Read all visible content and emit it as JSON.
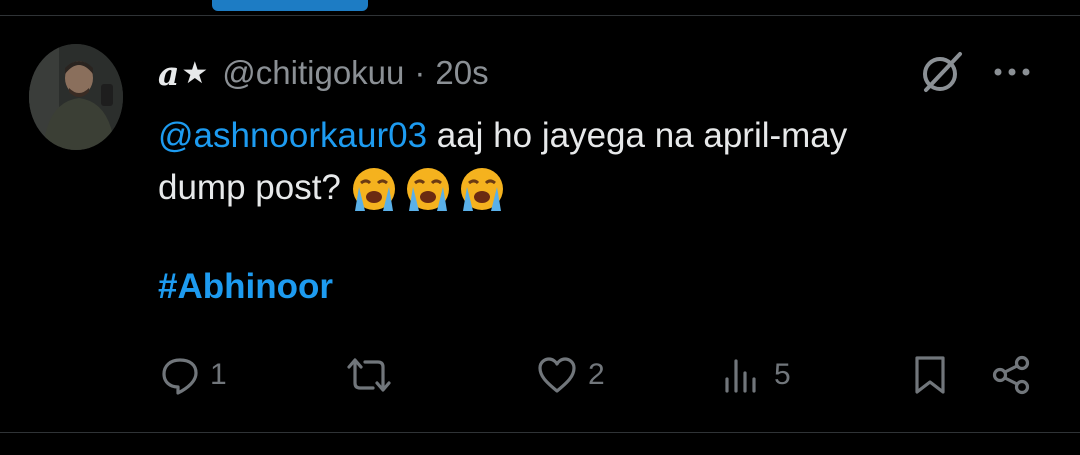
{
  "tweet": {
    "display_name": "a",
    "display_name_badge": "★",
    "handle": "@chitigokuu",
    "separator": "·",
    "timestamp": "20s",
    "mention": "@ashnoorkaur03",
    "text_line1": " aaj ho jayega na april-may",
    "text_line2": "dump post?",
    "emojis": [
      "😭",
      "😭",
      "😭"
    ],
    "hashtag": "#Abhinoor"
  },
  "actions": {
    "replies": "1",
    "reposts": "",
    "likes": "2",
    "views": "5"
  },
  "icons": {
    "header": [
      "grok-icon",
      "more-icon"
    ],
    "actions": [
      "reply-icon",
      "repost-icon",
      "like-icon",
      "views-icon",
      "bookmark-icon",
      "share-icon"
    ]
  },
  "colors": {
    "accent": "#1d9bf0",
    "muted": "#71767b",
    "background": "#000000"
  }
}
